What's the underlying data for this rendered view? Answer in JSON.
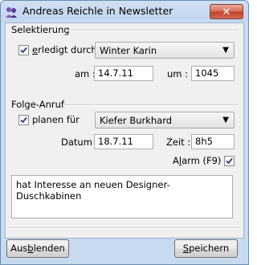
{
  "window": {
    "title": "Andreas Reichle in Newsletter",
    "close_symbol": "✕"
  },
  "selektierung": {
    "section_label": "Selektierung",
    "erledigt_checked": true,
    "erledigt_label_underlined": "e",
    "erledigt_label_rest": "rledigt durch",
    "user_value": "Winter Karin",
    "am_label": "am :",
    "am_value": "14.7.11",
    "um_label": "um :",
    "um_value": "1045"
  },
  "folge_anruf": {
    "section_label": "Folge-Anruf",
    "planen_checked": true,
    "planen_label": "planen für",
    "user_value": "Kiefer Burkhard",
    "datum_label": "Datum :",
    "datum_value": "18.7.11",
    "zeit_label": "Zeit :",
    "zeit_value": "8h5",
    "alarm_label_pre": "A",
    "alarm_label_underlined": "l",
    "alarm_label_rest": "arm (F9)",
    "alarm_checked": true
  },
  "note": "hat Interesse an neuen Designer-Duschkabinen",
  "buttons": {
    "hide_pre": "Aus",
    "hide_underlined": "b",
    "hide_rest": "lenden",
    "save_underlined": "S",
    "save_rest": "peichern"
  }
}
